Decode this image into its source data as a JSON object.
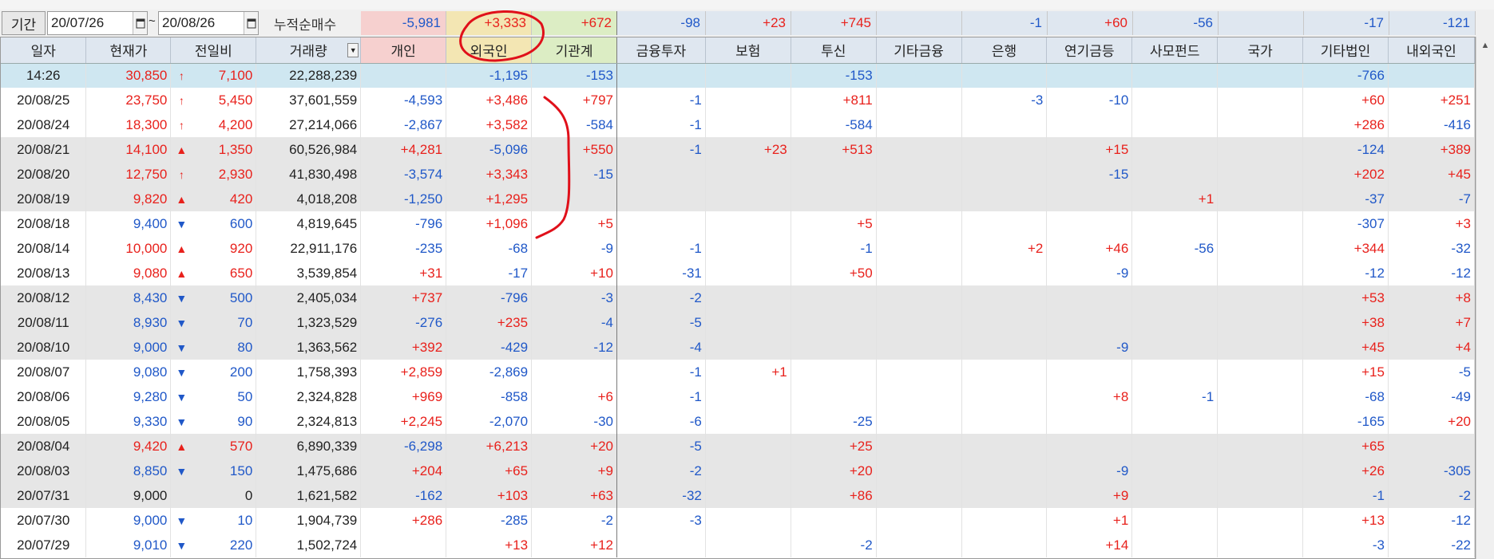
{
  "toolbar": {
    "period_label": "기간",
    "start_date": "20/07/26",
    "end_date": "20/08/26",
    "tilde": "~",
    "cumulative_label": "누적순매수"
  },
  "summary": {
    "individual": "-5,981",
    "foreign": "+3,333",
    "institution": "+672",
    "fin_invest": "-98",
    "insurance": "+23",
    "trust": "+745",
    "other_fin": "",
    "bank": "-1",
    "pension": "+60",
    "private_fund": "-56",
    "nation": "",
    "other_corp": "-17",
    "domestic_foreign": "-121"
  },
  "headers": [
    "일자",
    "현재가",
    "전일비",
    "거래량",
    "개인",
    "외국인",
    "기관계",
    "금융투자",
    "보험",
    "투신",
    "기타금융",
    "은행",
    "연기금등",
    "사모펀드",
    "국가",
    "기타법인",
    "내외국인"
  ],
  "rows": [
    {
      "style": "current",
      "date": "14:26",
      "price": "30,850",
      "price_dir": "pos",
      "arrow": "up-bold",
      "change": "7,100",
      "volume": "22,288,239",
      "ind": "",
      "for": "-1,195",
      "inst": "-153",
      "fin": "",
      "ins": "",
      "trust": "-153",
      "ofin": "",
      "bank": "",
      "pen": "",
      "pf": "",
      "nat": "",
      "ocorp": "-766",
      "dom": ""
    },
    {
      "style": "white",
      "date": "20/08/25",
      "price": "23,750",
      "price_dir": "pos",
      "arrow": "up-bold",
      "change": "5,450",
      "volume": "37,601,559",
      "ind": "-4,593",
      "for": "+3,486",
      "inst": "+797",
      "fin": "-1",
      "ins": "",
      "trust": "+811",
      "ofin": "",
      "bank": "-3",
      "pen": "-10",
      "pf": "",
      "nat": "",
      "ocorp": "+60",
      "dom": "+251"
    },
    {
      "style": "white",
      "date": "20/08/24",
      "price": "18,300",
      "price_dir": "pos",
      "arrow": "up-bold",
      "change": "4,200",
      "volume": "27,214,066",
      "ind": "-2,867",
      "for": "+3,582",
      "inst": "-584",
      "fin": "-1",
      "ins": "",
      "trust": "-584",
      "ofin": "",
      "bank": "",
      "pen": "",
      "pf": "",
      "nat": "",
      "ocorp": "+286",
      "dom": "-416"
    },
    {
      "style": "grey",
      "date": "20/08/21",
      "price": "14,100",
      "price_dir": "pos",
      "arrow": "up",
      "change": "1,350",
      "volume": "60,526,984",
      "ind": "+4,281",
      "for": "-5,096",
      "inst": "+550",
      "fin": "-1",
      "ins": "+23",
      "trust": "+513",
      "ofin": "",
      "bank": "",
      "pen": "+15",
      "pf": "",
      "nat": "",
      "ocorp": "-124",
      "dom": "+389"
    },
    {
      "style": "grey",
      "date": "20/08/20",
      "price": "12,750",
      "price_dir": "pos",
      "arrow": "up-bold",
      "change": "2,930",
      "volume": "41,830,498",
      "ind": "-3,574",
      "for": "+3,343",
      "inst": "-15",
      "fin": "",
      "ins": "",
      "trust": "",
      "ofin": "",
      "bank": "",
      "pen": "-15",
      "pf": "",
      "nat": "",
      "ocorp": "+202",
      "dom": "+45"
    },
    {
      "style": "grey",
      "date": "20/08/19",
      "price": "9,820",
      "price_dir": "pos",
      "arrow": "up",
      "change": "420",
      "volume": "4,018,208",
      "ind": "-1,250",
      "for": "+1,295",
      "inst": "",
      "fin": "",
      "ins": "",
      "trust": "",
      "ofin": "",
      "bank": "",
      "pen": "",
      "pf": "+1",
      "nat": "",
      "ocorp": "-37",
      "dom": "-7"
    },
    {
      "style": "white",
      "date": "20/08/18",
      "price": "9,400",
      "price_dir": "neg",
      "arrow": "down",
      "change": "600",
      "volume": "4,819,645",
      "ind": "-796",
      "for": "+1,096",
      "inst": "+5",
      "fin": "",
      "ins": "",
      "trust": "+5",
      "ofin": "",
      "bank": "",
      "pen": "",
      "pf": "",
      "nat": "",
      "ocorp": "-307",
      "dom": "+3"
    },
    {
      "style": "white",
      "date": "20/08/14",
      "price": "10,000",
      "price_dir": "pos",
      "arrow": "up",
      "change": "920",
      "volume": "22,911,176",
      "ind": "-235",
      "for": "-68",
      "inst": "-9",
      "fin": "-1",
      "ins": "",
      "trust": "-1",
      "ofin": "",
      "bank": "+2",
      "pen": "+46",
      "pf": "-56",
      "nat": "",
      "ocorp": "+344",
      "dom": "-32"
    },
    {
      "style": "white",
      "date": "20/08/13",
      "price": "9,080",
      "price_dir": "pos",
      "arrow": "up",
      "change": "650",
      "volume": "3,539,854",
      "ind": "+31",
      "for": "-17",
      "inst": "+10",
      "fin": "-31",
      "ins": "",
      "trust": "+50",
      "ofin": "",
      "bank": "",
      "pen": "-9",
      "pf": "",
      "nat": "",
      "ocorp": "-12",
      "dom": "-12"
    },
    {
      "style": "grey",
      "date": "20/08/12",
      "price": "8,430",
      "price_dir": "neg",
      "arrow": "down",
      "change": "500",
      "volume": "2,405,034",
      "ind": "+737",
      "for": "-796",
      "inst": "-3",
      "fin": "-2",
      "ins": "",
      "trust": "",
      "ofin": "",
      "bank": "",
      "pen": "",
      "pf": "",
      "nat": "",
      "ocorp": "+53",
      "dom": "+8"
    },
    {
      "style": "grey",
      "date": "20/08/11",
      "price": "8,930",
      "price_dir": "neg",
      "arrow": "down",
      "change": "70",
      "volume": "1,323,529",
      "ind": "-276",
      "for": "+235",
      "inst": "-4",
      "fin": "-5",
      "ins": "",
      "trust": "",
      "ofin": "",
      "bank": "",
      "pen": "",
      "pf": "",
      "nat": "",
      "ocorp": "+38",
      "dom": "+7"
    },
    {
      "style": "grey",
      "date": "20/08/10",
      "price": "9,000",
      "price_dir": "neg",
      "arrow": "down",
      "change": "80",
      "volume": "1,363,562",
      "ind": "+392",
      "for": "-429",
      "inst": "-12",
      "fin": "-4",
      "ins": "",
      "trust": "",
      "ofin": "",
      "bank": "",
      "pen": "-9",
      "pf": "",
      "nat": "",
      "ocorp": "+45",
      "dom": "+4"
    },
    {
      "style": "white",
      "date": "20/08/07",
      "price": "9,080",
      "price_dir": "neg",
      "arrow": "down",
      "change": "200",
      "volume": "1,758,393",
      "ind": "+2,859",
      "for": "-2,869",
      "inst": "",
      "fin": "-1",
      "ins": "+1",
      "trust": "",
      "ofin": "",
      "bank": "",
      "pen": "",
      "pf": "",
      "nat": "",
      "ocorp": "+15",
      "dom": "-5"
    },
    {
      "style": "white",
      "date": "20/08/06",
      "price": "9,280",
      "price_dir": "neg",
      "arrow": "down",
      "change": "50",
      "volume": "2,324,828",
      "ind": "+969",
      "for": "-858",
      "inst": "+6",
      "fin": "-1",
      "ins": "",
      "trust": "",
      "ofin": "",
      "bank": "",
      "pen": "+8",
      "pf": "-1",
      "nat": "",
      "ocorp": "-68",
      "dom": "-49"
    },
    {
      "style": "white",
      "date": "20/08/05",
      "price": "9,330",
      "price_dir": "neg",
      "arrow": "down",
      "change": "90",
      "volume": "2,324,813",
      "ind": "+2,245",
      "for": "-2,070",
      "inst": "-30",
      "fin": "-6",
      "ins": "",
      "trust": "-25",
      "ofin": "",
      "bank": "",
      "pen": "",
      "pf": "",
      "nat": "",
      "ocorp": "-165",
      "dom": "+20"
    },
    {
      "style": "grey",
      "date": "20/08/04",
      "price": "9,420",
      "price_dir": "pos",
      "arrow": "up",
      "change": "570",
      "volume": "6,890,339",
      "ind": "-6,298",
      "for": "+6,213",
      "inst": "+20",
      "fin": "-5",
      "ins": "",
      "trust": "+25",
      "ofin": "",
      "bank": "",
      "pen": "",
      "pf": "",
      "nat": "",
      "ocorp": "+65",
      "dom": ""
    },
    {
      "style": "grey",
      "date": "20/08/03",
      "price": "8,850",
      "price_dir": "neg",
      "arrow": "down",
      "change": "150",
      "volume": "1,475,686",
      "ind": "+204",
      "for": "+65",
      "inst": "+9",
      "fin": "-2",
      "ins": "",
      "trust": "+20",
      "ofin": "",
      "bank": "",
      "pen": "-9",
      "pf": "",
      "nat": "",
      "ocorp": "+26",
      "dom": "-305"
    },
    {
      "style": "grey",
      "date": "20/07/31",
      "price": "9,000",
      "price_dir": "neu",
      "arrow": "",
      "change": "0",
      "volume": "1,621,582",
      "ind": "-162",
      "for": "+103",
      "inst": "+63",
      "fin": "-32",
      "ins": "",
      "trust": "+86",
      "ofin": "",
      "bank": "",
      "pen": "+9",
      "pf": "",
      "nat": "",
      "ocorp": "-1",
      "dom": "-2"
    },
    {
      "style": "white",
      "date": "20/07/30",
      "price": "9,000",
      "price_dir": "neg",
      "arrow": "down",
      "change": "10",
      "volume": "1,904,739",
      "ind": "+286",
      "for": "-285",
      "inst": "-2",
      "fin": "-3",
      "ins": "",
      "trust": "",
      "ofin": "",
      "bank": "",
      "pen": "+1",
      "pf": "",
      "nat": "",
      "ocorp": "+13",
      "dom": "-12"
    },
    {
      "style": "white",
      "date": "20/07/29",
      "price": "9,010",
      "price_dir": "neg",
      "arrow": "down",
      "change": "220",
      "volume": "1,502,724",
      "ind": "",
      "for": "+13",
      "inst": "+12",
      "fin": "",
      "ins": "",
      "trust": "-2",
      "ofin": "",
      "bank": "",
      "pen": "+14",
      "pf": "",
      "nat": "",
      "ocorp": "-3",
      "dom": "-22"
    }
  ],
  "colors": {
    "positive": "#e8211c",
    "negative": "#2058c8",
    "annotation": "#e0101a"
  },
  "icons": {
    "calendar": "calendar-icon",
    "sort": "dropdown-arrow-icon",
    "up_bold": "arrow-up-icon",
    "up": "triangle-up-icon",
    "down": "triangle-down-icon"
  }
}
